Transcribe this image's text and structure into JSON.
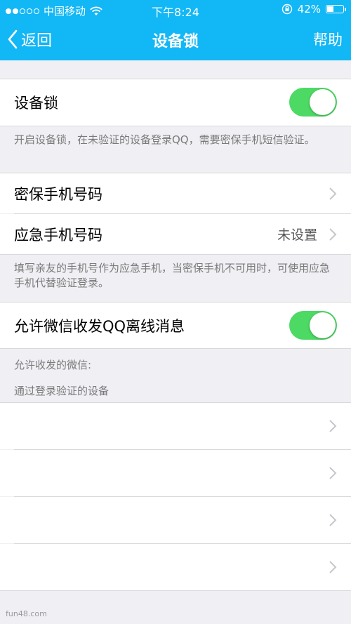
{
  "status_bar": {
    "carrier": "中国移动",
    "time": "下午8:24",
    "battery": "42%",
    "battery_level": 0.42,
    "signal_icon": "signal-dots-icon",
    "wifi_icon": "wifi-icon",
    "lock_icon": "orientation-lock-icon"
  },
  "nav": {
    "back_label": "返回",
    "title": "设备锁",
    "help_label": "帮助"
  },
  "device_lock": {
    "label": "设备锁",
    "enabled": true,
    "note": "开启设备锁，在未验证的设备登录QQ，需要密保手机短信验证。"
  },
  "phones": {
    "secure_phone_label": "密保手机号码",
    "emergency_phone_label": "应急手机号码",
    "emergency_phone_value": "未设置",
    "note": "填写亲友的手机号作为应急手机，当密保手机不可用时，可使用应急手机代替验证登录。"
  },
  "wechat": {
    "label": "允许微信收发QQ离线消息",
    "enabled": true,
    "allowed_label": "允许收发的微信:"
  },
  "devices": {
    "header": "通过登录验证的设备",
    "items": [
      "",
      "",
      "",
      ""
    ]
  },
  "watermark": "fun48.com",
  "colors": {
    "header_bg": "#12b7f5",
    "toggle_on": "#4cd964",
    "page_bg": "#efeff4"
  }
}
